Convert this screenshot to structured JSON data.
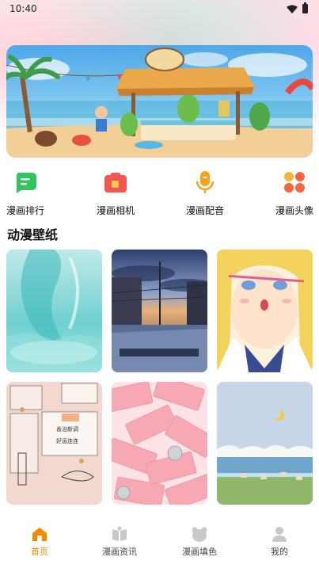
{
  "status_bar": {
    "time": "10:40"
  },
  "banner": {
    "alt_icon": "beach-cafe-illustration"
  },
  "features": [
    {
      "label": "漫画排行",
      "icon": "chat-lines-icon",
      "color": "#2fc45c"
    },
    {
      "label": "漫画相机",
      "icon": "camera-icon",
      "color": "#f2584f"
    },
    {
      "label": "漫画配音",
      "icon": "microphone-icon",
      "color": "#f7a21b"
    },
    {
      "label": "漫画头像",
      "icon": "four-dots-icon",
      "color": "#f6653e"
    }
  ],
  "wallpaper_section": {
    "title": "动漫壁纸"
  },
  "wallpapers": [
    {
      "name": "ocean-wave-wallpaper"
    },
    {
      "name": "city-street-dusk-wallpaper"
    },
    {
      "name": "anime-girl-wallpaper"
    },
    {
      "name": "sketch-collage-wallpaper"
    },
    {
      "name": "banknotes-wallpaper"
    },
    {
      "name": "beach-moon-pixel-wallpaper"
    }
  ],
  "sketch_text": {
    "line1": "善治新调",
    "line2": "好运连连"
  },
  "bottom_nav": [
    {
      "label": "首页",
      "icon": "home-icon",
      "active": true
    },
    {
      "label": "漫画资讯",
      "icon": "book-icon",
      "active": false
    },
    {
      "label": "漫画填色",
      "icon": "bear-icon",
      "active": false
    },
    {
      "label": "我的",
      "icon": "person-icon",
      "active": false
    }
  ],
  "colors": {
    "accent": "#f08a00",
    "inactive_nav": "#c8c8c8"
  }
}
